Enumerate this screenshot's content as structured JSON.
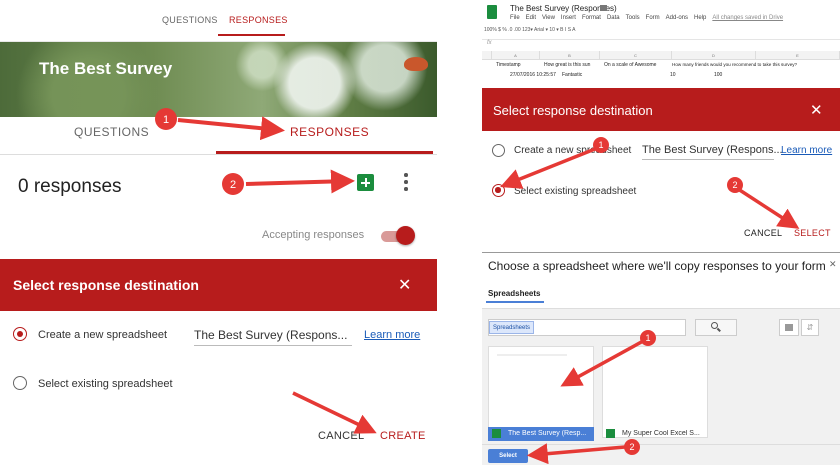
{
  "left": {
    "top_tabs": [
      "QUESTIONS",
      "RESPONSES"
    ],
    "banner_title": "The Best Survey",
    "tabs": [
      "QUESTIONS",
      "RESPONSES"
    ],
    "responses_count": "0 responses",
    "accepting_label": "Accepting responses",
    "accepting_on": true,
    "dialog": {
      "title": "Select response destination",
      "close_icon": "close-icon",
      "option_new": "Create a new spreadsheet",
      "option_new_selected": true,
      "sheet_name": "The Best Survey (Respons...",
      "learn_more": "Learn more",
      "option_existing": "Select existing spreadsheet",
      "cancel": "CANCEL",
      "create": "CREATE"
    },
    "annotations": [
      "1",
      "2"
    ]
  },
  "right": {
    "doc_title": "The Best Survey (Responses)",
    "menu": [
      "File",
      "Edit",
      "View",
      "Insert",
      "Format",
      "Data",
      "Tools",
      "Form",
      "Add-ons",
      "Help"
    ],
    "saved_status": "All changes saved in Drive",
    "toolbar_text": "100%    $  %  .0  .00  123▾    Arial    ▾    10    ▾    B  I  S  A",
    "fx": "fx",
    "columns": [
      "A",
      "B",
      "C",
      "D",
      "E"
    ],
    "header_row": [
      "Timestamp",
      "How great is this sun",
      "On a scale of Awesome",
      "How many friends would you recommend to take this survey?"
    ],
    "data_row": [
      "27/07/2016 10:25:57",
      "Fantastic",
      "10",
      "100"
    ],
    "dialog": {
      "title": "Select response destination",
      "option_new": "Create a new spreadsheet",
      "sheet_name": "The Best Survey (Respons...",
      "learn_more": "Learn more",
      "option_existing": "Select existing spreadsheet",
      "option_existing_selected": true,
      "cancel": "CANCEL",
      "select": "SELECT"
    },
    "picker": {
      "heading": "Choose a spreadsheet where we'll copy responses to your form",
      "tab": "Spreadsheets",
      "search_chip": "Spreadsheets",
      "files": [
        "The Best Survey (Resp...",
        "My Super Cool Excel S..."
      ],
      "select_button": "Select"
    },
    "annotations": [
      "1",
      "2",
      "1",
      "2"
    ]
  },
  "colors": {
    "brand_red": "#b71c1c",
    "annotation_red": "#e53935",
    "sheets_green": "#1b8d3e",
    "picker_blue": "#4a7fd6"
  }
}
